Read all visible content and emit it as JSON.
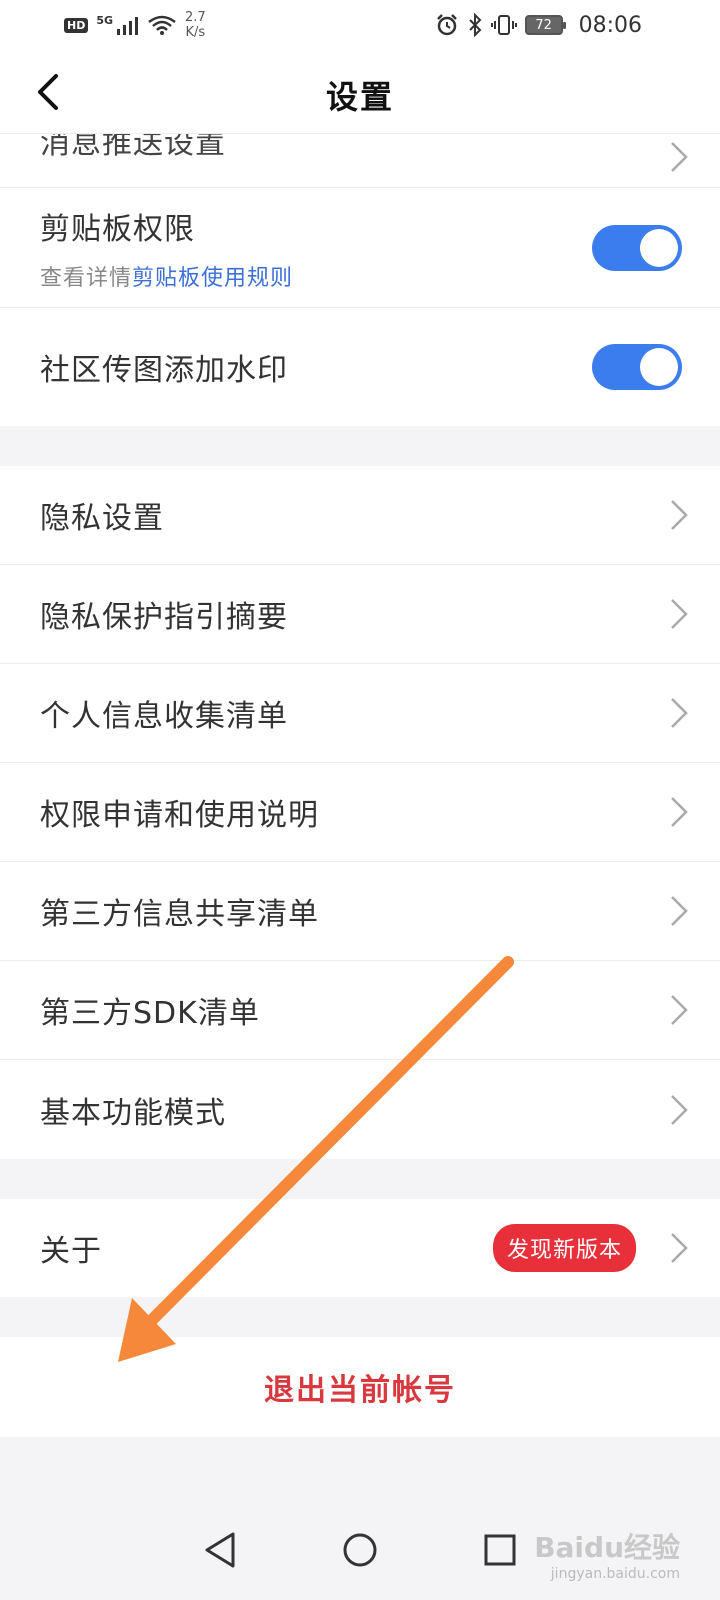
{
  "status_bar": {
    "hd": "HD",
    "network": "5G",
    "speed_value": "2.7",
    "speed_unit": "K/s",
    "battery": "72",
    "time": "08:06"
  },
  "header": {
    "title": "设置"
  },
  "settings": {
    "partial_item": "消息推送设置",
    "clipboard": {
      "label": "剪贴板权限",
      "sub_prefix": "查看详情",
      "sub_link": "剪贴板使用规则",
      "enabled": true
    },
    "watermark_toggle": {
      "label": "社区传图添加水印",
      "enabled": true
    },
    "privacy_items": [
      {
        "label": "隐私设置"
      },
      {
        "label": "隐私保护指引摘要"
      },
      {
        "label": "个人信息收集清单"
      },
      {
        "label": "权限申请和使用说明"
      },
      {
        "label": "第三方信息共享清单"
      },
      {
        "label": "第三方SDK清单"
      },
      {
        "label": "基本功能模式"
      }
    ],
    "about": {
      "label": "关于",
      "badge": "发现新版本"
    },
    "logout": "退出当前帐号"
  },
  "watermark": {
    "brand": "Baidu经验",
    "url": "jingyan.baidu.com"
  },
  "colors": {
    "toggle_on": "#3b7ded",
    "link": "#3d6fd9",
    "badge": "#e8303a",
    "logout": "#d9393e",
    "arrow": "#f5883a"
  }
}
